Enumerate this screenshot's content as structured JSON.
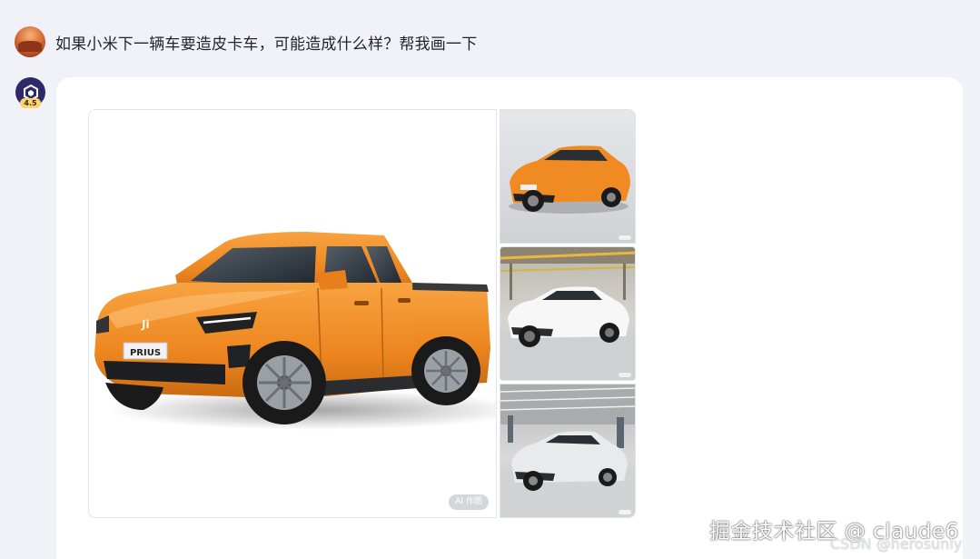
{
  "conversation": {
    "user_message": "如果小米下一辆车要造皮卡车，可能造成什么样？帮我画一下",
    "bot_version_badge": "4.5"
  },
  "generated_images": {
    "main_plate_text": "PRIUS",
    "main_badge_text": "AI 作图",
    "thumbnail_count": 3
  },
  "watermark": {
    "line1": "掘金技术社区 @ claude6",
    "line2": "CSDN @herosunly"
  },
  "colors": {
    "background": "#f1f2f8",
    "car_orange": "#f08a22",
    "bot_avatar": "#2d2a6a"
  }
}
